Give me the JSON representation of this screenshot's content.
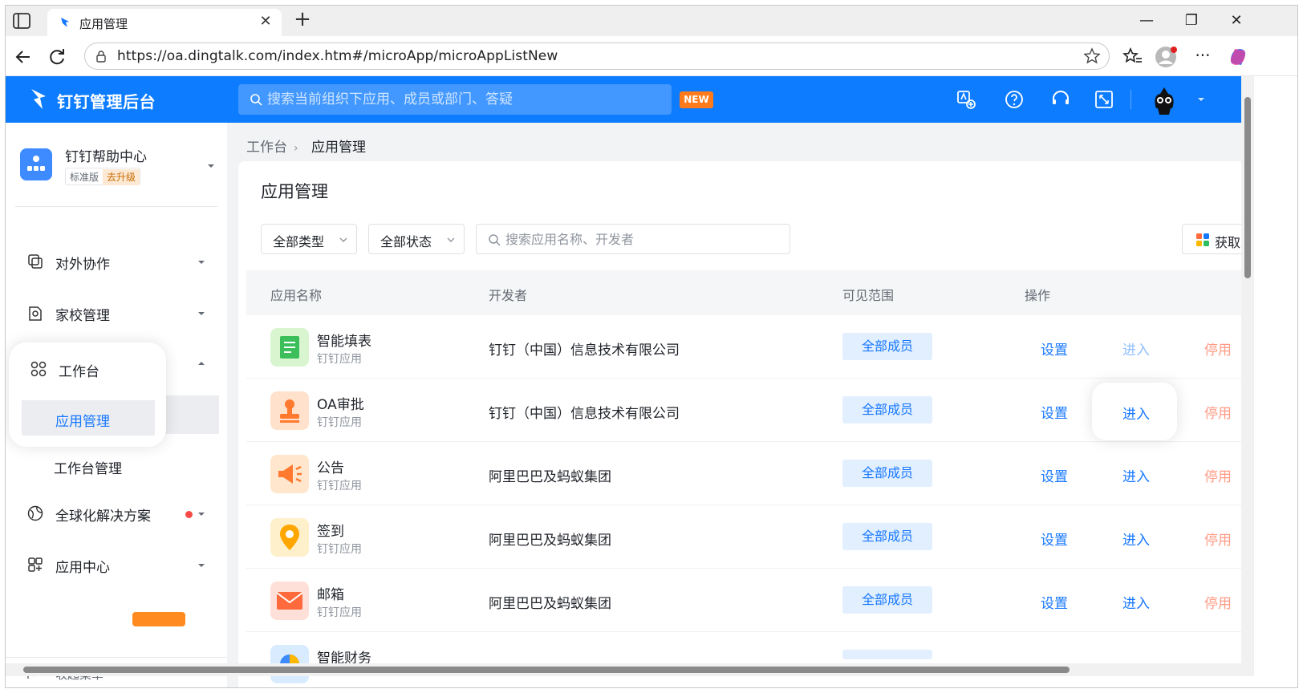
{
  "browser": {
    "tab_title": "应用管理",
    "url": "https://oa.dingtalk.com/index.htm#/microApp/microAppListNew"
  },
  "header": {
    "app_title": "钉钉管理后台",
    "search_placeholder": "搜索当前组织下应用、成员或部门、答疑",
    "new_badge": "NEW"
  },
  "org": {
    "name": "钉钉帮助中心",
    "edition": "标准版",
    "upgrade": "去升级"
  },
  "sidebar": {
    "items": [
      {
        "label": "对外协作"
      },
      {
        "label": "家校管理"
      },
      {
        "label": "工作台"
      },
      {
        "label": "全球化解决方案"
      },
      {
        "label": "应用中心"
      }
    ],
    "sub_items": [
      {
        "label": "应用管理"
      },
      {
        "label": "工作台管理"
      }
    ],
    "collapse_label": "收起菜单"
  },
  "breadcrumb": {
    "root": "工作台",
    "current": "应用管理"
  },
  "main": {
    "title": "应用管理",
    "filter_type": "全部类型",
    "filter_status": "全部状态",
    "search_placeholder": "搜索应用名称、开发者",
    "get_button": "获取"
  },
  "table": {
    "headers": [
      "应用名称",
      "开发者",
      "可见范围",
      "操作"
    ],
    "rows": [
      {
        "name": "智能填表",
        "type": "钉钉应用",
        "developer": "钉钉（中国）信息技术有限公司",
        "scope": "全部成员",
        "set": "设置",
        "enter": "进入",
        "stop": "停用"
      },
      {
        "name": "OA审批",
        "type": "钉钉应用",
        "developer": "钉钉（中国）信息技术有限公司",
        "scope": "全部成员",
        "set": "设置",
        "enter": "进入",
        "stop": "停用"
      },
      {
        "name": "公告",
        "type": "钉钉应用",
        "developer": "阿里巴巴及蚂蚁集团",
        "scope": "全部成员",
        "set": "设置",
        "enter": "进入",
        "stop": "停用"
      },
      {
        "name": "签到",
        "type": "钉钉应用",
        "developer": "阿里巴巴及蚂蚁集团",
        "scope": "全部成员",
        "set": "设置",
        "enter": "进入",
        "stop": "停用"
      },
      {
        "name": "邮箱",
        "type": "钉钉应用",
        "developer": "阿里巴巴及蚂蚁集团",
        "scope": "全部成员",
        "set": "设置",
        "enter": "进入",
        "stop": "停用"
      },
      {
        "name": "智能财务",
        "type": "",
        "developer": "",
        "scope": "",
        "set": "",
        "enter": "",
        "stop": ""
      }
    ]
  },
  "colors": {
    "brand_blue": "#0d7cff",
    "link_blue": "#1677ff",
    "stop_orange": "#ff9b85",
    "new_badge": "#ff7a1a"
  }
}
